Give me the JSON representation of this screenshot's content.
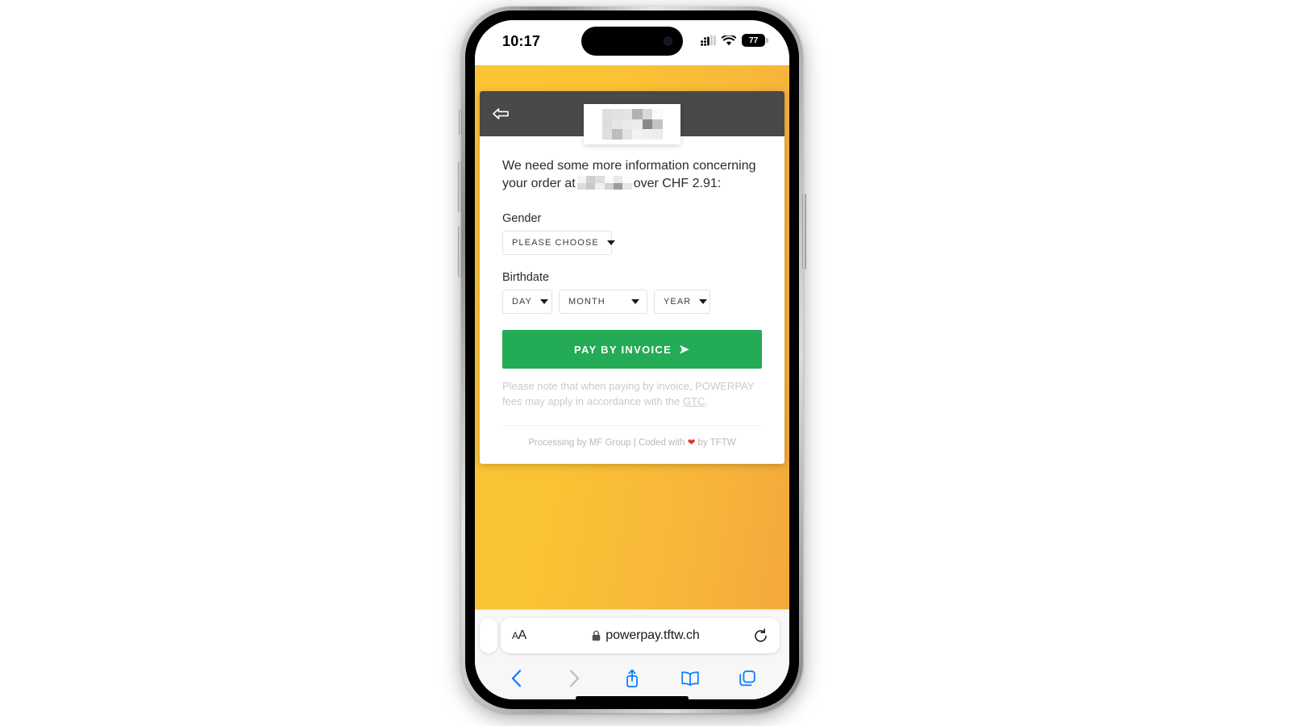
{
  "device": {
    "status_bar": {
      "time": "10:17",
      "signal_icon": "cellular-signal-icon",
      "wifi_icon": "wifi-icon",
      "battery_percent": "77"
    },
    "home_indicator": "home-indicator"
  },
  "colors": {
    "page_background_start": "#FBC434",
    "page_background_end": "#F3A83C",
    "header_bar": "#494949",
    "pay_button": "#24AB55",
    "disclaimer_text": "#CACACA",
    "safari_accent": "#0A7CFF"
  },
  "page": {
    "header": {
      "back_icon": "back-arrow-icon",
      "logo_alt": "merchant-logo-redacted"
    },
    "intro": {
      "part1": "We need some more information concerning your order at",
      "redacted": "merchant-name-redacted",
      "part2": "over CHF 2.91:",
      "amount": "CHF 2.91"
    },
    "form": {
      "gender": {
        "label": "Gender",
        "select_value": "PLEASE CHOOSE",
        "caret_icon": "chevron-down-icon"
      },
      "birthdate": {
        "label": "Birthdate",
        "day_value": "DAY",
        "month_value": "MONTH",
        "year_value": "YEAR"
      }
    },
    "submit": {
      "label": "PAY BY INVOICE",
      "arrow_icon": "arrow-right-icon"
    },
    "disclaimer": {
      "text_before": "Please note that when paying by invoice, POWERPAY fees may apply in accordance with the",
      "link_label": "GTC",
      "text_after": "."
    },
    "footer": {
      "text_before": "Processing by MF Group | Coded with",
      "heart_icon": "❤",
      "text_after": "by TFTW"
    }
  },
  "browser": {
    "text_size_label": "AA",
    "lock_icon": "lock-icon",
    "url": "powerpay.tftw.ch",
    "reload_icon": "reload-icon",
    "toolbar": {
      "back_icon": "chevron-left-icon",
      "forward_icon": "chevron-right-icon",
      "share_icon": "share-icon",
      "bookmarks_icon": "book-icon",
      "tabs_icon": "tabs-icon"
    }
  }
}
